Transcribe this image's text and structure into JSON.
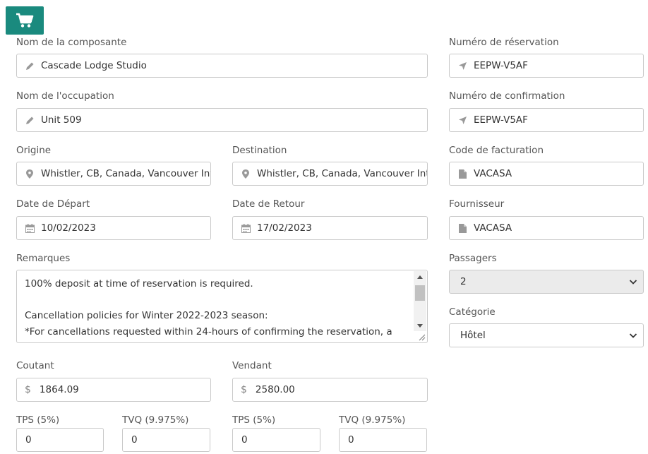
{
  "cart": {
    "icon": "shopping-cart-icon",
    "color": "#1a8a7e"
  },
  "labels": {
    "component_name": "Nom de la composante",
    "occupation_name": "Nom de l'occupation",
    "origin": "Origine",
    "destination": "Destination",
    "departure_date": "Date de Départ",
    "return_date": "Date de Retour",
    "remarks": "Remarques",
    "cost": "Coutant",
    "selling": "Vendant",
    "tps_cost": "TPS (5%)",
    "tvq_cost": "TVQ (9.975%)",
    "tps_sell": "TPS (5%)",
    "tvq_sell": "TVQ (9.975%)",
    "reservation_number": "Numéro de réservation",
    "confirmation_number": "Numéro de confirmation",
    "billing_code": "Code de facturation",
    "supplier": "Fournisseur",
    "passengers": "Passagers",
    "category": "Catégorie"
  },
  "values": {
    "component_name": "Cascade Lodge Studio",
    "occupation_name": "Unit 509",
    "origin": "Whistler, CB, Canada, Vancouver Inte",
    "destination": "Whistler, CB, Canada, Vancouver Inte",
    "departure_date": "10/02/2023",
    "return_date": "17/02/2023",
    "remarks": "100% deposit at time of reservation is required.\n\nCancellation policies for Winter 2022-2023 season:\n*For cancellations requested within 24-hours of confirming the reservation, a full refund.",
    "cost": "1864.09",
    "selling": "2580.00",
    "tps_cost": "0",
    "tvq_cost": "0",
    "tps_sell": "0",
    "tvq_sell": "0",
    "reservation_number": "EEPW-V5AF",
    "confirmation_number": "EEPW-V5AF",
    "billing_code": "VACASA",
    "supplier": "VACASA",
    "passengers": "2",
    "category": "Hôtel"
  },
  "icons": {
    "name": "pencil-icon",
    "location": "map-marker-icon",
    "date": "calendar-icon",
    "reference": "location-arrow-icon",
    "document": "file-icon",
    "currency": "$"
  }
}
